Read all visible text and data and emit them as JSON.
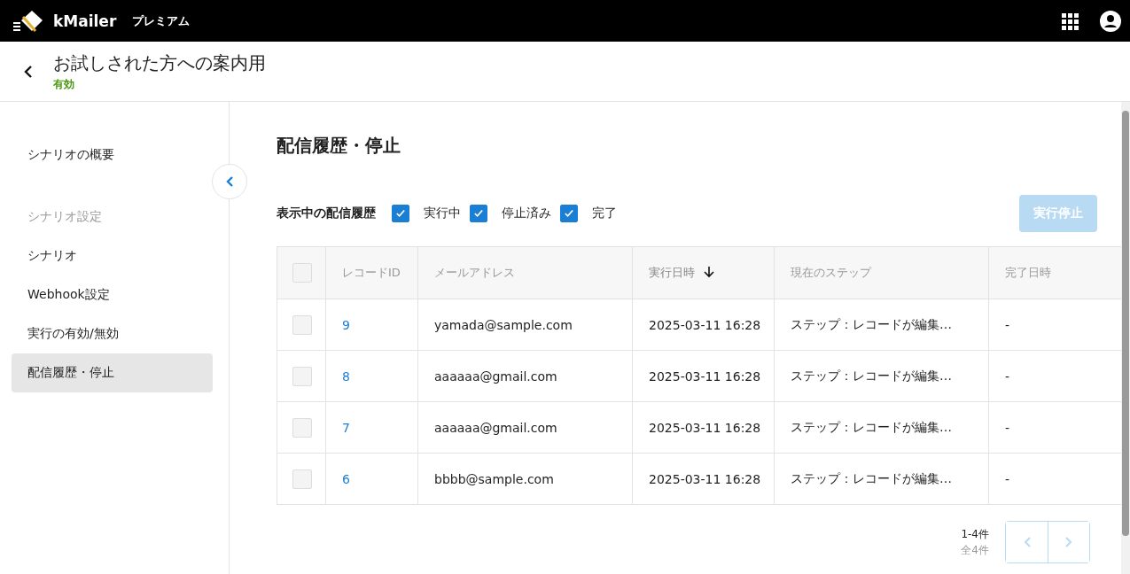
{
  "topbar": {
    "brand": "kMailer",
    "plan": "プレミアム"
  },
  "header": {
    "title": "お試しされた方への案内用",
    "status": "有効"
  },
  "sidebar": {
    "items": [
      {
        "kind": "link",
        "label": "シナリオの概要",
        "selected": false
      },
      {
        "kind": "heading",
        "label": "シナリオ設定"
      },
      {
        "kind": "link",
        "label": "シナリオ",
        "selected": false
      },
      {
        "kind": "link",
        "label": "Webhook設定",
        "selected": false
      },
      {
        "kind": "link",
        "label": "実行の有効/無効",
        "selected": false
      },
      {
        "kind": "link",
        "label": "配信履歴・停止",
        "selected": true
      }
    ]
  },
  "main": {
    "title": "配信履歴・停止",
    "filter_label": "表示中の配信履歴",
    "filters": [
      {
        "label": "実行中",
        "checked": true
      },
      {
        "label": "停止済み",
        "checked": true
      },
      {
        "label": "完了",
        "checked": true
      }
    ],
    "stop_button": {
      "label": "実行停止",
      "disabled": true
    },
    "table": {
      "select_all": {
        "checked": false
      },
      "columns": [
        {
          "label": "レコードID",
          "sorted": false
        },
        {
          "label": "メールアドレス",
          "sorted": false
        },
        {
          "label": "実行日時",
          "sorted": true
        },
        {
          "label": "現在のステップ",
          "sorted": false
        },
        {
          "label": "完了日時",
          "sorted": false
        }
      ],
      "rows": [
        {
          "checked": false,
          "cells": [
            "9",
            "yamada@sample.com",
            "2025-03-11 16:28",
            "ステップ：レコードが編集…",
            "-"
          ]
        },
        {
          "checked": false,
          "cells": [
            "8",
            "aaaaaa@gmail.com",
            "2025-03-11 16:28",
            "ステップ：レコードが編集…",
            "-"
          ]
        },
        {
          "checked": false,
          "cells": [
            "7",
            "aaaaaa@gmail.com",
            "2025-03-11 16:28",
            "ステップ：レコードが編集…",
            "-"
          ]
        },
        {
          "checked": false,
          "cells": [
            "6",
            "bbbb@sample.com",
            "2025-03-11 16:28",
            "ステップ：レコードが編集…",
            "-"
          ]
        }
      ]
    },
    "pagination": {
      "range": "1-4件",
      "total": "全4件"
    }
  }
}
